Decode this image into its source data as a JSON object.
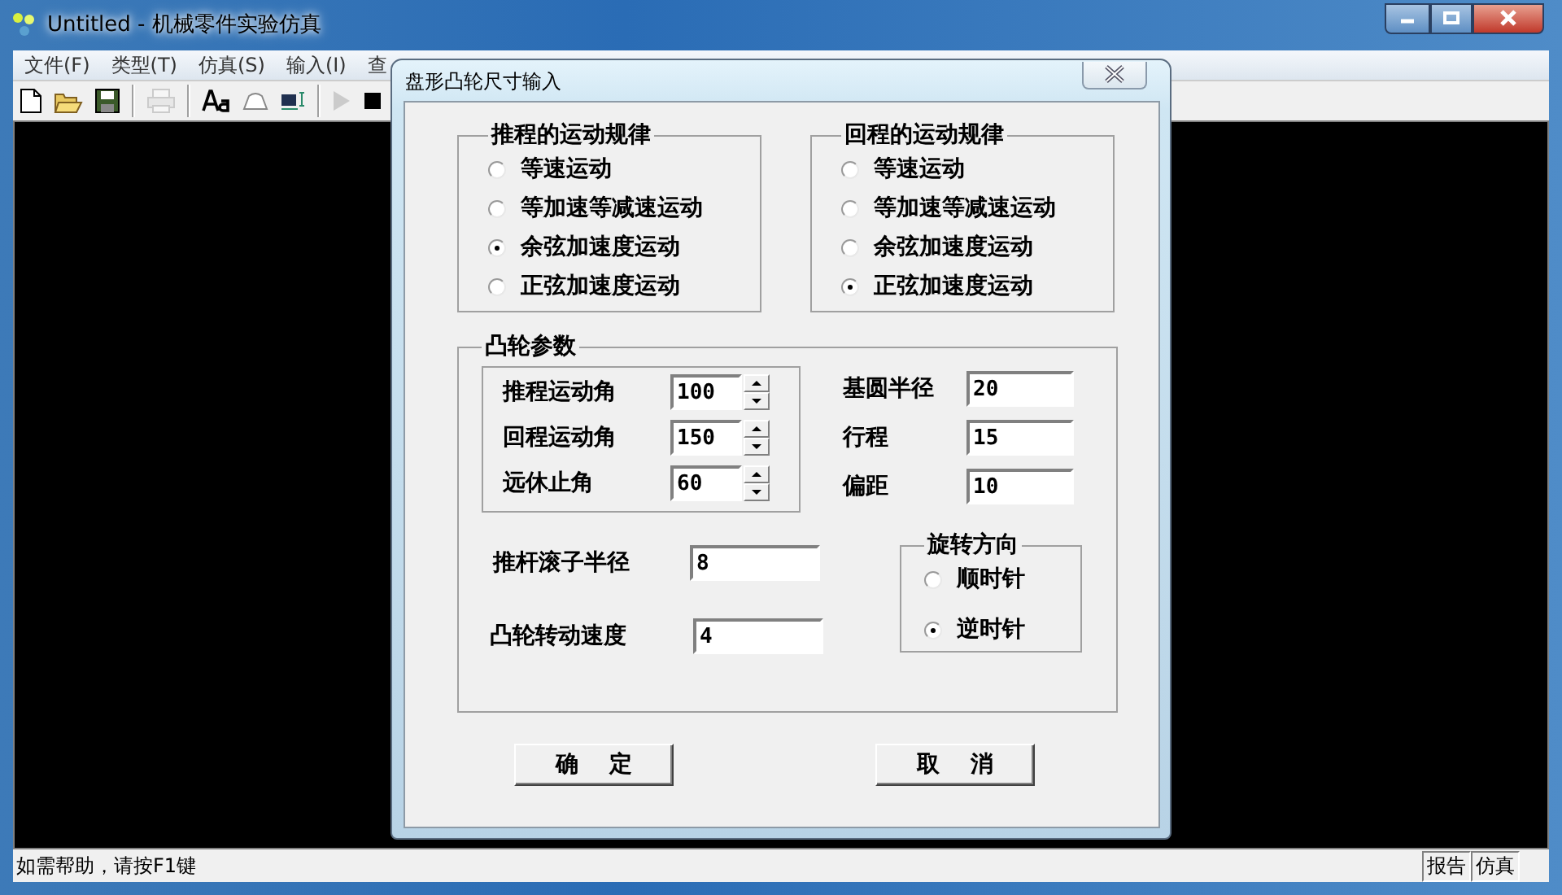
{
  "window": {
    "title": "Untitled - 机械零件实验仿真"
  },
  "menu": [
    "文件(F)",
    "类型(T)",
    "仿真(S)",
    "输入(I)",
    "查"
  ],
  "toolbar": [
    {
      "kind": "new",
      "disabled": false
    },
    {
      "kind": "open",
      "disabled": false
    },
    {
      "kind": "save",
      "disabled": false
    },
    {
      "kind": "separator"
    },
    {
      "kind": "print",
      "disabled": true
    },
    {
      "kind": "separator"
    },
    {
      "kind": "font",
      "disabled": false
    },
    {
      "kind": "cam",
      "disabled": false
    },
    {
      "kind": "window",
      "disabled": false
    },
    {
      "kind": "separator"
    },
    {
      "kind": "play",
      "disabled": true
    },
    {
      "kind": "stop",
      "disabled": false
    }
  ],
  "dialog": {
    "title": "盘形凸轮尺寸输入",
    "motion_groups": [
      {
        "title": "推程的运动规律",
        "options": [
          {
            "label": "等速运动",
            "selected": false
          },
          {
            "label": "等加速等减速运动",
            "selected": false
          },
          {
            "label": "余弦加速度运动",
            "selected": true
          },
          {
            "label": "正弦加速度运动",
            "selected": false
          }
        ]
      },
      {
        "title": "回程的运动规律",
        "options": [
          {
            "label": "等速运动",
            "selected": false
          },
          {
            "label": "等加速等减速运动",
            "selected": false
          },
          {
            "label": "余弦加速度运动",
            "selected": false
          },
          {
            "label": "正弦加速度运动",
            "selected": true
          }
        ]
      }
    ],
    "cam_params": {
      "title": "凸轮参数",
      "angles": [
        {
          "label": "推程运动角",
          "value": "100"
        },
        {
          "label": "回程运动角",
          "value": "150"
        },
        {
          "label": "远休止角",
          "value": "60"
        }
      ],
      "fields": [
        {
          "label": "基圆半径",
          "value": "20"
        },
        {
          "label": "行程",
          "value": "15"
        },
        {
          "label": "偏距",
          "value": "10"
        }
      ],
      "roller_radius": {
        "label": "推杆滚子半径",
        "value": "8"
      },
      "speed": {
        "label": "凸轮转动速度",
        "value": "4"
      },
      "direction": {
        "title": "旋转方向",
        "options": [
          {
            "label": "顺时针",
            "selected": false
          },
          {
            "label": "逆时针",
            "selected": true
          }
        ]
      }
    },
    "buttons": [
      "确    定",
      "取    消"
    ]
  },
  "status_bar": {
    "text": "如需帮助，请按F1键",
    "panels": [
      "报告",
      "仿真"
    ]
  }
}
